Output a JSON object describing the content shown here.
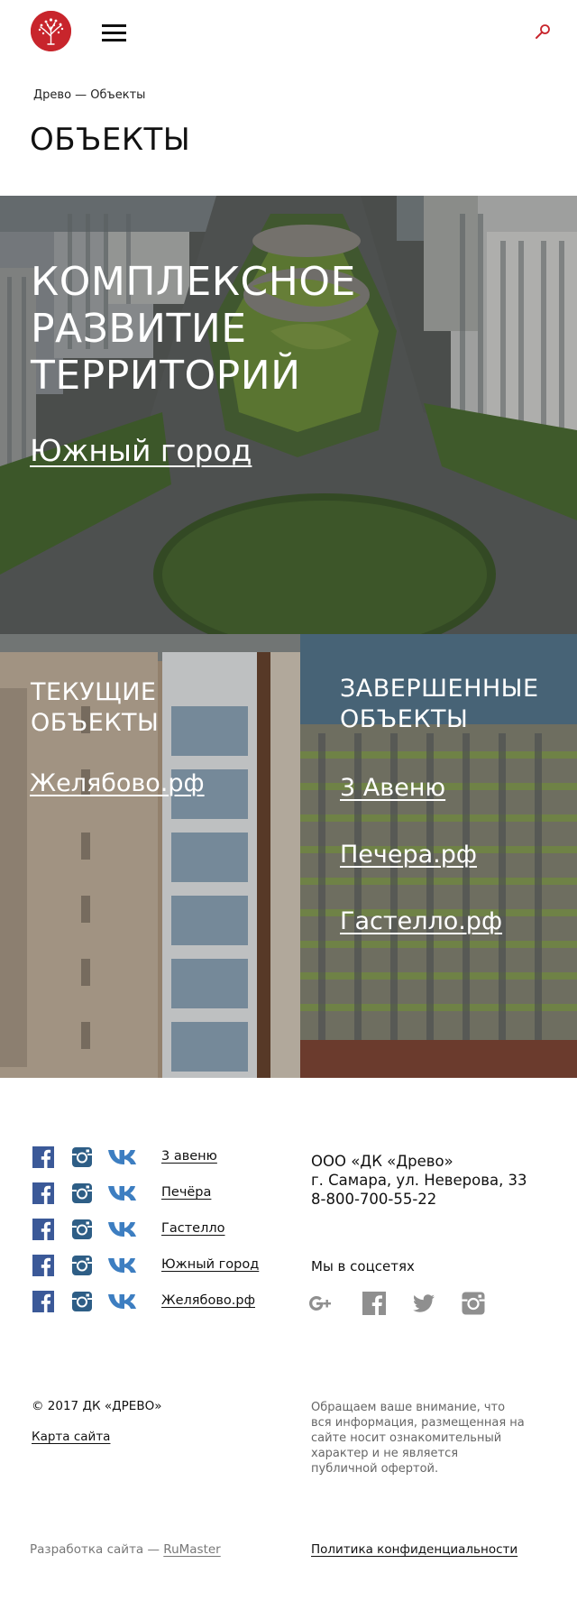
{
  "header": {
    "logo_icon": "tree-logo-icon",
    "menu_icon": "hamburger-icon",
    "search_icon": "search-icon",
    "brand_color": "#c8252c"
  },
  "breadcrumb": "Древо — Объекты",
  "page_title": "ОБЪЕКТЫ",
  "hero": {
    "title_lines": [
      "КОМПЛЕКСНОЕ",
      "РАЗВИТИЕ",
      "ТЕРРИТОРИЙ"
    ],
    "link": "Южный город"
  },
  "current": {
    "title_lines": [
      "ТЕКУЩИЕ",
      "ОБЪЕКТЫ"
    ],
    "links": [
      "Желябово.рф"
    ]
  },
  "completed": {
    "title_lines": [
      "ЗАВЕРШЕННЫЕ",
      "ОБЪЕКТЫ"
    ],
    "links": [
      "3 Авеню",
      "Печера.рф",
      "Гастелло.рф"
    ]
  },
  "footer": {
    "projects": [
      {
        "label": "3 авеню",
        "icons": [
          "facebook-icon",
          "instagram-icon",
          "vk-icon"
        ]
      },
      {
        "label": "Печёра",
        "icons": [
          "facebook-icon",
          "instagram-icon",
          "vk-icon"
        ]
      },
      {
        "label": "Гастелло",
        "icons": [
          "facebook-icon",
          "instagram-icon",
          "vk-icon"
        ]
      },
      {
        "label": "Южный город",
        "icons": [
          "facebook-icon",
          "instagram-icon",
          "vk-icon"
        ]
      },
      {
        "label": "Желябово.рф",
        "icons": [
          "facebook-icon",
          "instagram-icon",
          "vk-icon"
        ]
      }
    ],
    "company": {
      "name": "ООО «ДК «Древо»",
      "address": "г. Самара, ул. Неверова, 33",
      "phone": "8-800-700-55-22"
    },
    "social_title": "Мы в соцсетях",
    "social_icons": [
      "google-plus-icon",
      "facebook-icon",
      "twitter-icon",
      "instagram-icon"
    ],
    "copyright": "© 2017 ДК «ДРЕВО»",
    "sitemap": "Карта сайта",
    "disclaimer": "Обращаем ваше внимание, что вся информация, размещенная на сайте носит ознакомительный характер и не является публичной офертой.",
    "dev_prefix": "Разработка сайта — ",
    "dev_link": "RuMaster",
    "privacy": "Политика конфиденциальности",
    "colors": {
      "facebook": "#3b5998",
      "instagram": "#2e5e86",
      "vk": "#3d7ec1",
      "social_gray": "#8f8f8f"
    }
  }
}
